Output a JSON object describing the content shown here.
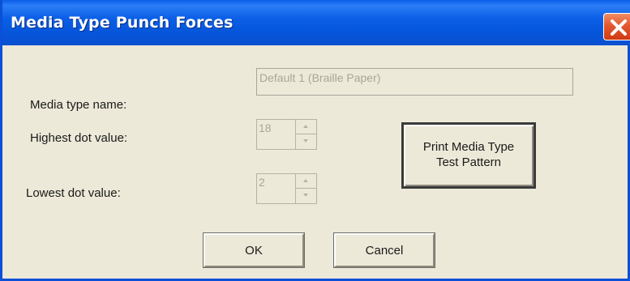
{
  "window": {
    "title": "Media Type Punch Forces",
    "close_label": "close"
  },
  "form": {
    "media_type_name": {
      "label": "Media type name:",
      "value": "Default 1 (Braille Paper)"
    },
    "highest_dot": {
      "label": "Highest dot value:",
      "value": "18"
    },
    "lowest_dot": {
      "label": "Lowest dot value:",
      "value": "2"
    }
  },
  "buttons": {
    "print_test_line1": "Print Media Type",
    "print_test_line2": "Test Pattern",
    "ok": "OK",
    "cancel": "Cancel"
  },
  "colors": {
    "titlebar": "#0a5de8",
    "face": "#ece9d8",
    "close": "#e4582e",
    "disabled_text": "#a7a699"
  }
}
